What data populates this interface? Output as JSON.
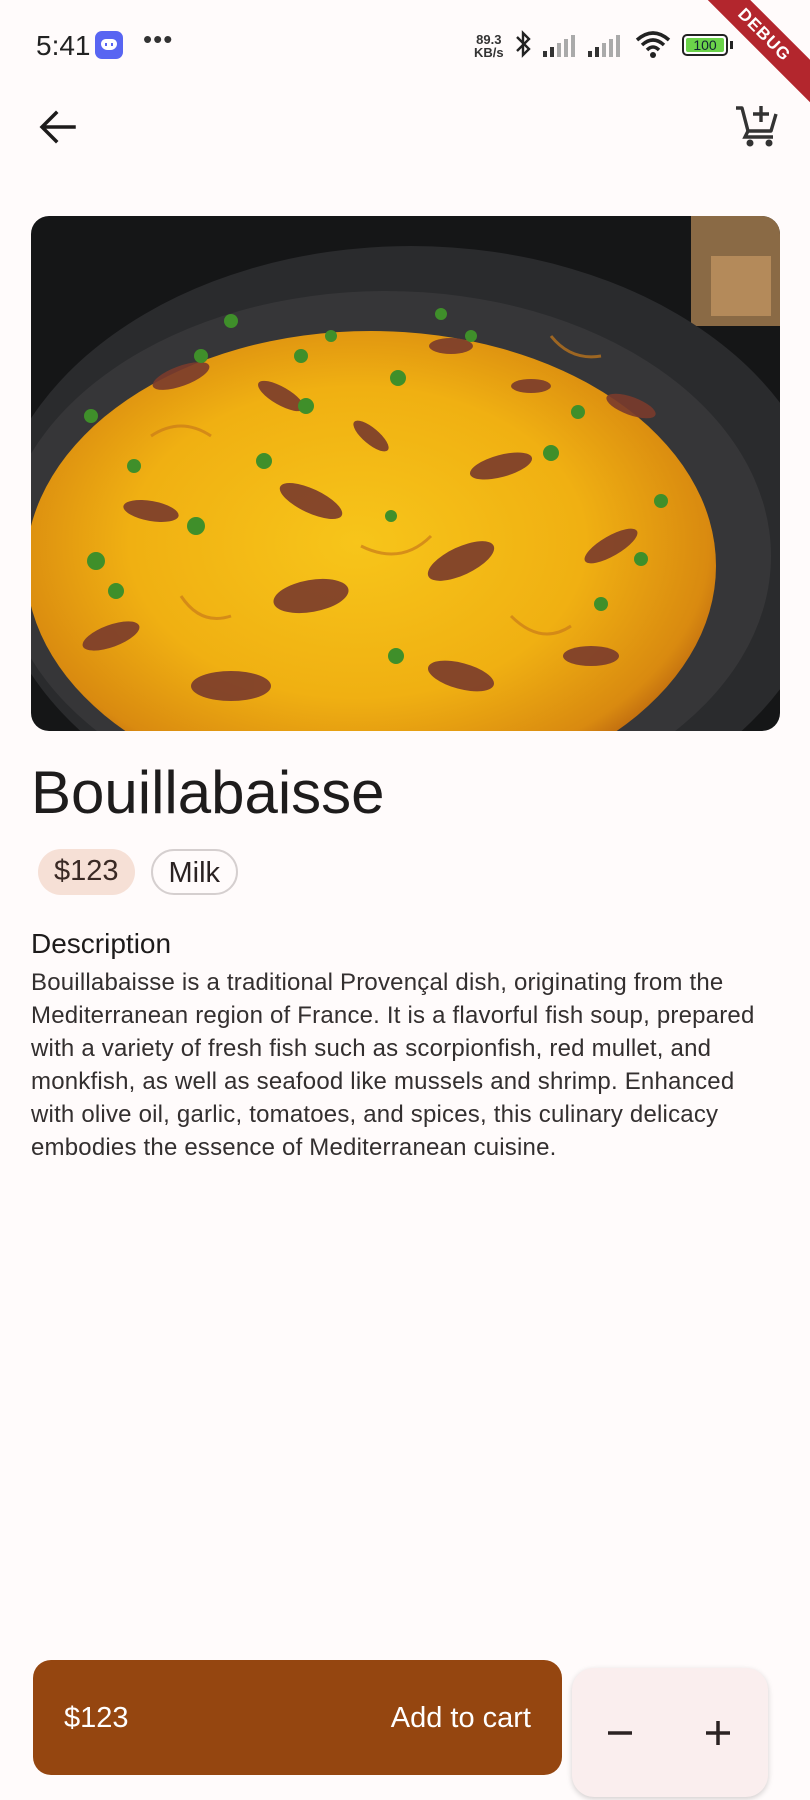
{
  "status_bar": {
    "time": "5:41",
    "net_speed_value": "89.3",
    "net_speed_unit": "KB/s",
    "battery": "100",
    "debug_label": "DEBUG"
  },
  "app_bar": {
    "back_icon": "arrow-left-icon",
    "cart_icon": "add-shopping-cart-icon"
  },
  "product": {
    "image_alt": "Bouillabaisse",
    "title": "Bouillabaisse",
    "price_chip": "$123",
    "tag_chip": "Milk",
    "description_heading": "Description",
    "description": "Bouillabaisse is a traditional Provençal dish, originating from the Mediterranean region of France. It is a flavorful fish soup, prepared with a variety of fresh fish such as scorpionfish, red mullet, and monkfish, as well as seafood like mussels and shrimp. Enhanced with olive oil, garlic, tomatoes, and spices, this culinary delicacy embodies the essence of Mediterranean cuisine."
  },
  "bottom_bar": {
    "price": "$123",
    "add_to_cart_label": "Add to cart",
    "minus_icon": "minus-icon",
    "plus_icon": "plus-icon"
  },
  "colors": {
    "accent": "#954610",
    "price_chip_bg": "#f6e0d6",
    "background": "#fffbfb",
    "stepper_bg": "#faeeee"
  }
}
